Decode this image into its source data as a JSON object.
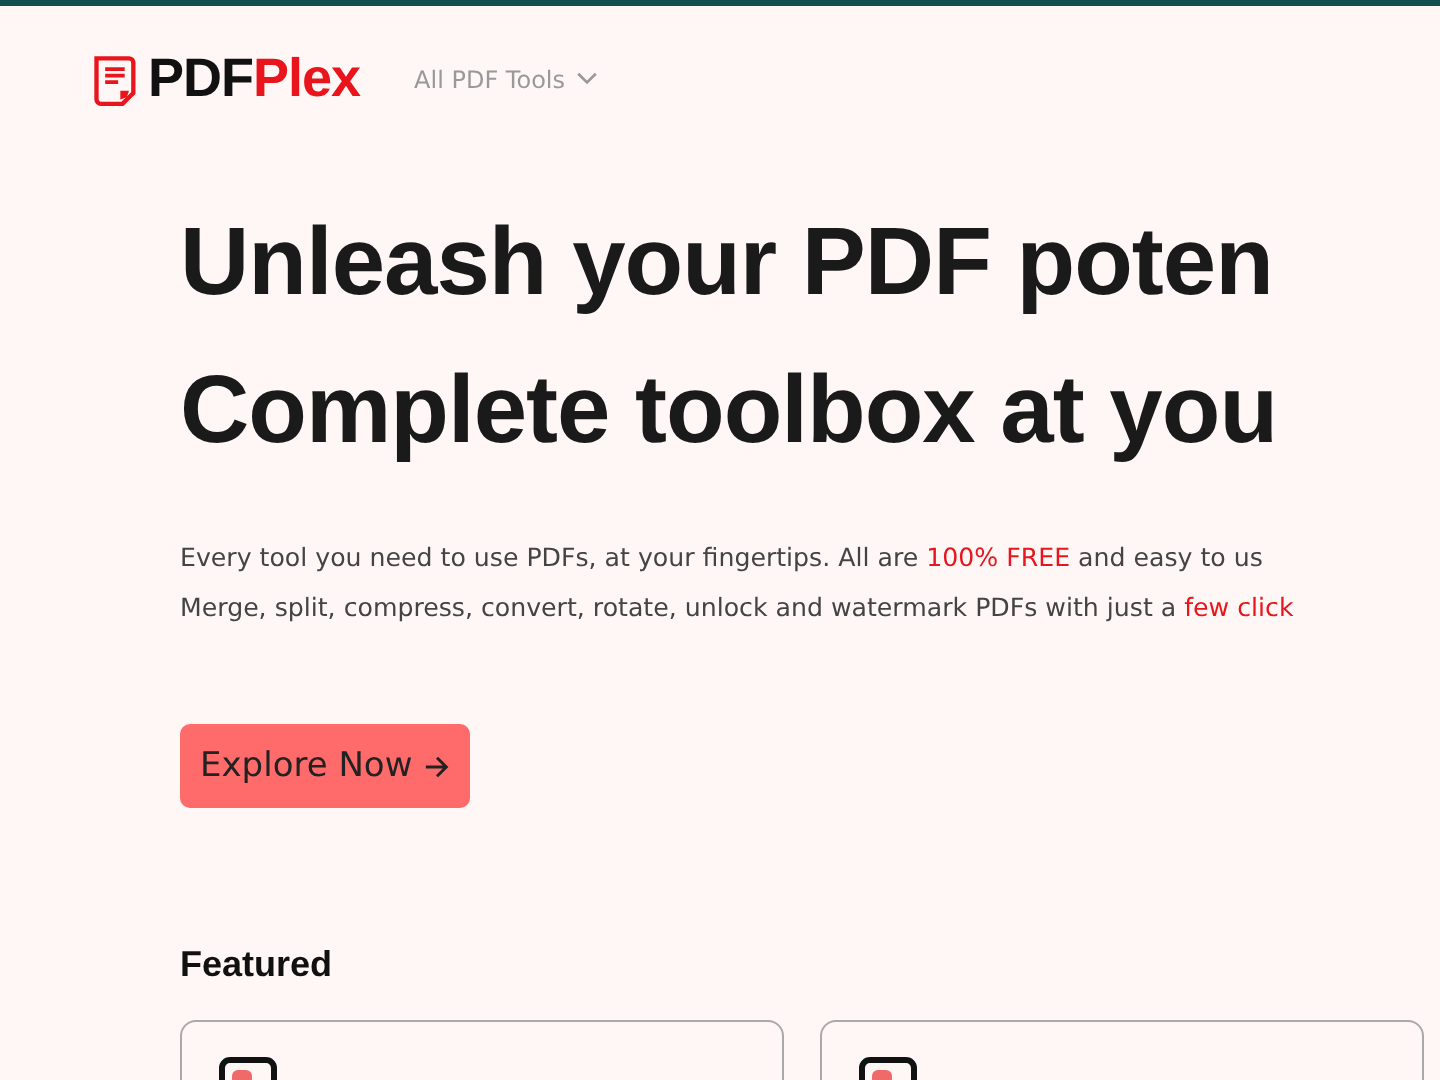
{
  "header": {
    "logo": [
      {
        "text": "PDF",
        "highlight": false
      },
      {
        "text": "Plex",
        "highlight": true
      }
    ],
    "nav_link": "All PDF Tools"
  },
  "hero": {
    "title_lines": [
      "Unleash your PDF poten",
      "Complete toolbox at you"
    ],
    "description_lines": [
      [
        {
          "text": "Every tool you need to use PDFs, at your fingertips. All are ",
          "highlight": false
        },
        {
          "text": "100% FREE",
          "highlight": true
        },
        {
          "text": " and easy to us",
          "highlight": false
        }
      ],
      [
        {
          "text": "Merge, split, compress, convert, rotate, unlock and watermark PDFs with just a ",
          "highlight": false
        },
        {
          "text": "few click",
          "highlight": true
        }
      ]
    ],
    "button": "Explore Now"
  },
  "featured": {
    "heading": "Featured"
  }
}
